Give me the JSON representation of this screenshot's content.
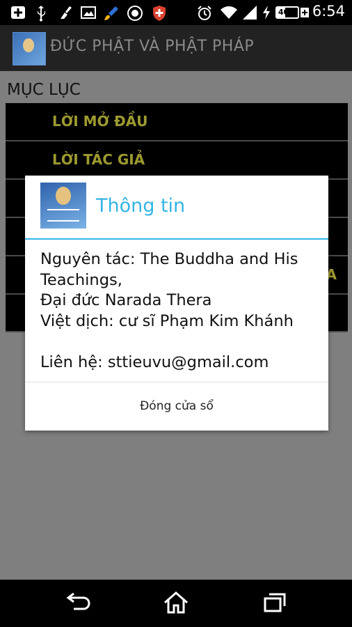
{
  "status_bar": {
    "icons": [
      "add-notification-icon",
      "usb-icon",
      "broom-icon",
      "image-icon",
      "brush-icon",
      "compass-icon",
      "shield-plus-icon",
      "alarm-icon",
      "wifi-icon",
      "signal-icon",
      "charging-icon",
      "battery-icon"
    ],
    "battery_percent": "40%",
    "battery_level": 0.4,
    "time": "6:54"
  },
  "action_bar": {
    "title": "ĐỨC PHẬT VÀ PHẬT PHÁP"
  },
  "main": {
    "heading": "MỤC LỤC",
    "items": [
      {
        "label": "LỜI MỞ ĐẦU"
      },
      {
        "label": "LỜI TÁC GIẢ"
      },
      {
        "label": ""
      },
      {
        "label": ""
      },
      {
        "label": "A"
      },
      {
        "label": ""
      }
    ]
  },
  "dialog": {
    "title": "Thông tin",
    "body": "Nguyên tác: The Buddha and His Teachings,\nĐại đức Narada Thera\nViệt dịch: cư sĩ Phạm Kim Khánh\n\nLiên hệ: sttieuvu@gmail.com",
    "button_label": "Đóng cửa sổ"
  },
  "colors": {
    "accent": "#33b5e5",
    "list_text": "#9d9a30",
    "scrim": "#7f7f7f"
  }
}
